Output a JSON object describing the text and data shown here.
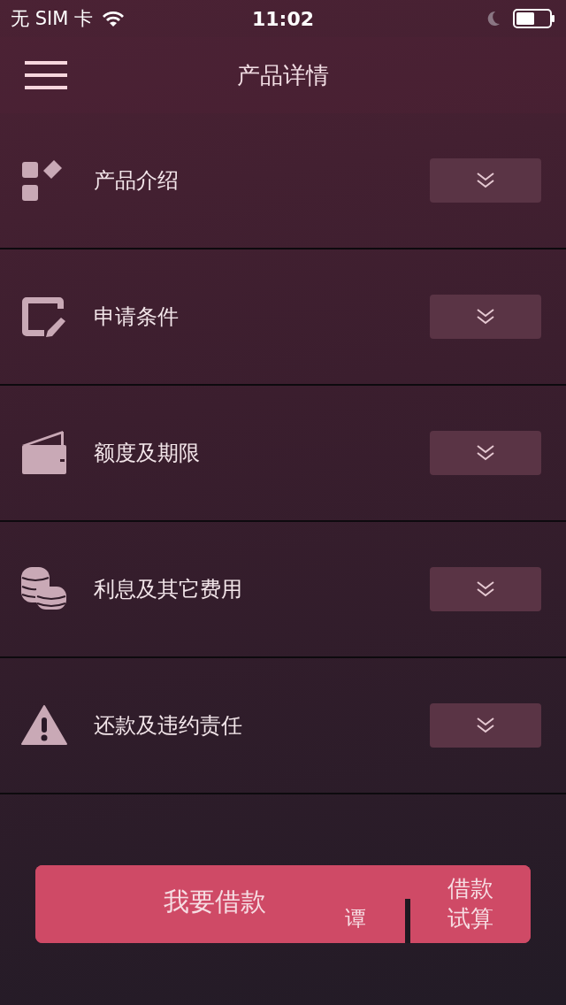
{
  "status_bar": {
    "carrier": "无 SIM 卡",
    "time": "11:02"
  },
  "nav": {
    "title": "产品详情"
  },
  "sections": [
    {
      "label": "产品介绍",
      "expanded": false
    },
    {
      "label": "申请条件",
      "expanded": false
    },
    {
      "label": "额度及期限",
      "expanded": false
    },
    {
      "label": "利息及其它费用",
      "expanded": false
    },
    {
      "label": "还款及违约责任",
      "expanded": false
    }
  ],
  "actions": {
    "primary": "我要借款",
    "stray": "谭",
    "secondary_lines": [
      "借款",
      "试算"
    ]
  }
}
